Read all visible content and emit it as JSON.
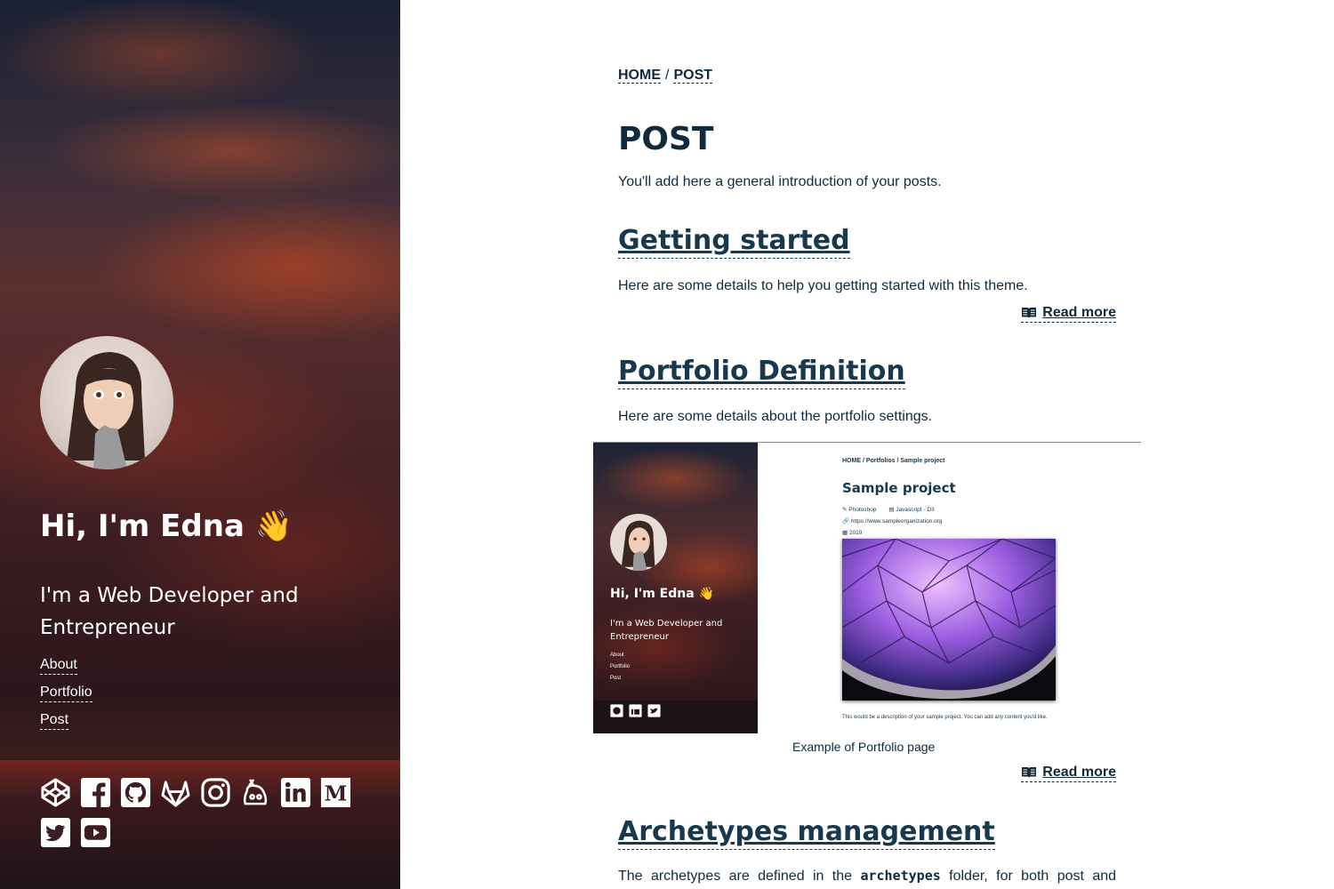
{
  "sidebar": {
    "greeting": "Hi, I'm Edna 👋",
    "tagline": "I'm a Web Developer and Entrepreneur",
    "nav": [
      {
        "label": "About"
      },
      {
        "label": "Portfolio"
      },
      {
        "label": "Post"
      }
    ],
    "social_icons": [
      "codepen-icon",
      "facebook-icon",
      "github-icon",
      "gitlab-icon",
      "instagram-icon",
      "keybase-icon",
      "linkedin-icon",
      "medium-icon",
      "twitter-icon",
      "youtube-icon"
    ]
  },
  "breadcrumb": {
    "home": "HOME",
    "separator": "/",
    "current": "POST"
  },
  "page": {
    "title": "POST",
    "intro": "You'll add here a general introduction of your posts."
  },
  "posts": [
    {
      "title": "Getting started",
      "summary": "Here are some details to help you getting started with this theme.",
      "read_more": "Read more"
    },
    {
      "title": "Portfolio Definition",
      "summary": "Here are some details about the portfolio settings.",
      "read_more": "Read more",
      "figure": {
        "caption": "Example of Portfolio page",
        "screenshot": {
          "breadcrumb": "HOME / Portfolios / Sample project",
          "title": "Sample project",
          "meta_tool": "Photoshop",
          "meta_tech": "Javascript - D3",
          "meta_url": "https://www.sampleorganization.org",
          "meta_year": "2019",
          "description": "This would be a description of your sample project. You can add any content you'd like.",
          "greeting": "Hi, I'm Edna 👋",
          "tagline": "I'm a Web Developer and Entrepreneur",
          "nav": [
            "About",
            "Portfolio",
            "Post"
          ]
        }
      }
    },
    {
      "title": "Archetypes management",
      "summary_before": "The archetypes are defined in the",
      "summary_code": "archetypes",
      "summary_after": "folder, for both post and"
    }
  ],
  "colors": {
    "text": "#102a3c",
    "heading": "#17384d",
    "sidebar_text": "#ffffff"
  }
}
